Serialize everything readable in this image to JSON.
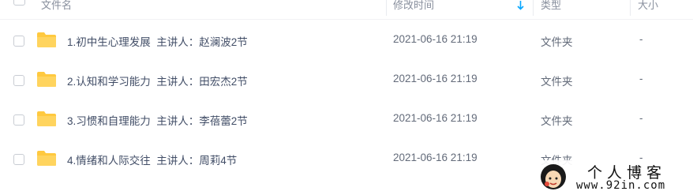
{
  "header": {
    "name_label": "文件名",
    "time_label": "修改时间",
    "type_label": "类型",
    "size_label": "大小",
    "sort_icon": "arrow-down-icon",
    "accent": "#06a7ff"
  },
  "files": [
    {
      "name": "1.初中生心理发展  主讲人：赵澜波2节",
      "time": "2021-06-16 21:19",
      "type": "文件夹",
      "size": "-"
    },
    {
      "name": "2.认知和学习能力  主讲人：田宏杰2节",
      "time": "2021-06-16 21:19",
      "type": "文件夹",
      "size": "-"
    },
    {
      "name": "3.习惯和自理能力  主讲人：李蓓蕾2节",
      "time": "2021-06-16 21:19",
      "type": "文件夹",
      "size": "-"
    },
    {
      "name": "4.情绪和人际交往  主讲人：周莉4节",
      "time": "2021-06-16 21:19",
      "type": "文件夹",
      "size": "-"
    }
  ],
  "folder_color": "#ffc93f",
  "watermark": {
    "title": "个人博客",
    "url": "www.92in.com"
  }
}
